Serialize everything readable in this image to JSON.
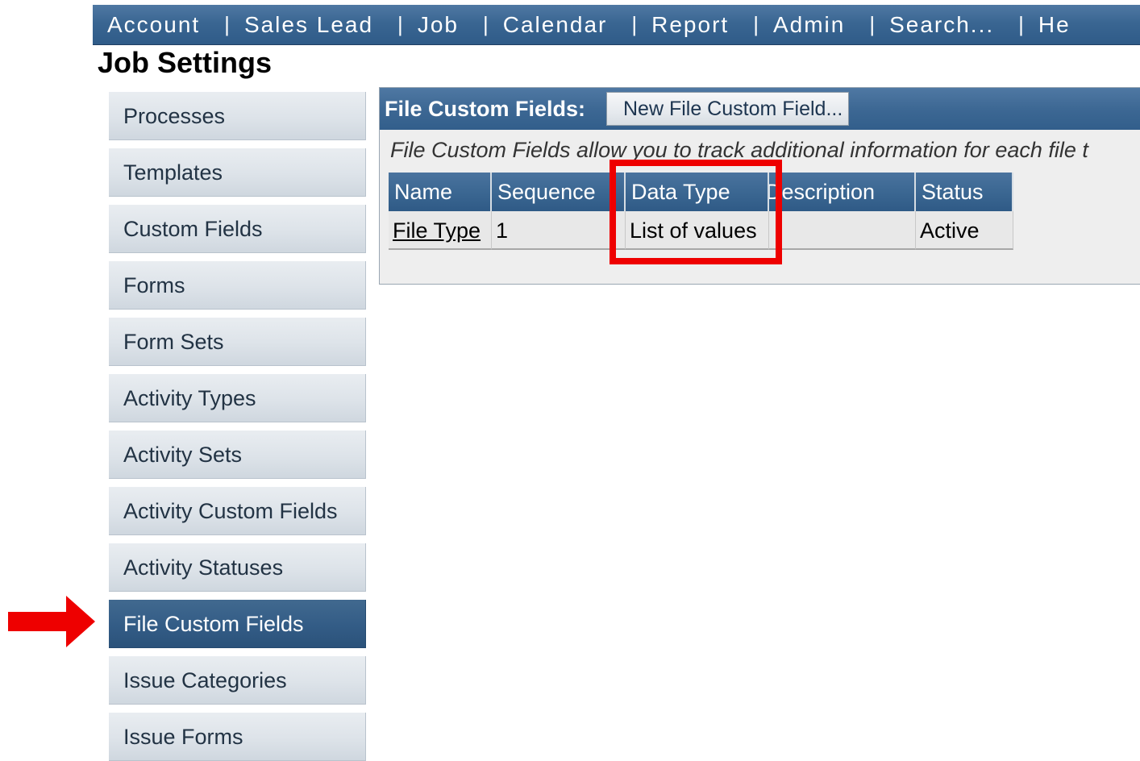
{
  "nav": {
    "items": [
      "Account",
      "Sales Lead",
      "Job",
      "Calendar",
      "Report",
      "Admin",
      "Search...",
      "He"
    ],
    "separator": "|"
  },
  "page_title": "Job Settings",
  "sidebar": {
    "items": [
      {
        "label": "Processes"
      },
      {
        "label": "Templates"
      },
      {
        "label": "Custom Fields"
      },
      {
        "label": "Forms"
      },
      {
        "label": "Form Sets"
      },
      {
        "label": "Activity Types"
      },
      {
        "label": "Activity Sets"
      },
      {
        "label": "Activity Custom Fields"
      },
      {
        "label": "Activity Statuses"
      },
      {
        "label": "File Custom Fields",
        "active": true
      },
      {
        "label": "Issue Categories"
      },
      {
        "label": "Issue Forms"
      }
    ]
  },
  "panel": {
    "title": "File Custom Fields:",
    "new_button": "New File Custom Field...",
    "description": "File Custom Fields allow you to track additional information for each file t",
    "table": {
      "columns": [
        "Name",
        "Sequence",
        "Data Type",
        "Description",
        "Status"
      ],
      "rows": [
        {
          "name": "File Type",
          "sequence": "1",
          "data_type": "List of values",
          "description": "",
          "status": "Active"
        }
      ]
    }
  },
  "annotations": {
    "highlight_color": "#ee0000",
    "arrow_color": "#ee0000"
  }
}
